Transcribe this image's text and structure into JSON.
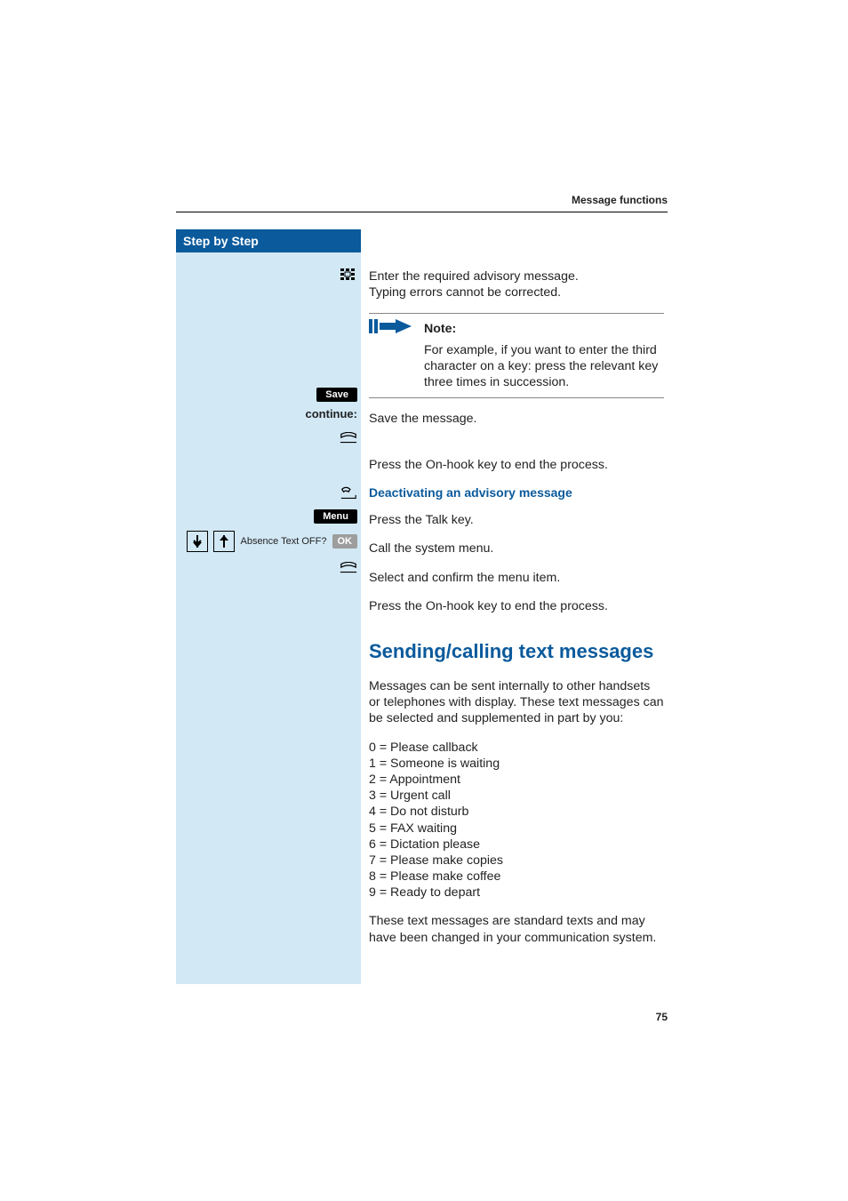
{
  "header": {
    "section": "Message functions"
  },
  "sidebar": {
    "title": "Step by Step"
  },
  "steps": {
    "save": "Save",
    "continue": "continue:",
    "menu": "Menu",
    "absence": "Absence Text OFF?",
    "ok": "OK"
  },
  "body": {
    "p1a": "Enter the required advisory message.",
    "p1b": "Typing errors cannot be corrected.",
    "note_label": "Note:",
    "note_text": "For example, if you want to enter the third character on a key: press the relevant key three times in succession.",
    "save_msg": "Save the message.",
    "onhook1": "Press the On-hook key to end the process.",
    "sub_deact": "Deactivating an advisory message",
    "talk": "Press the Talk key.",
    "callmenu": "Call the system menu.",
    "select": "Select and confirm the menu item.",
    "onhook2": "Press the On-hook key to end the process.",
    "h2": "Sending/calling text messages",
    "p2": "Messages can be sent internally to other handsets or telephones with display. These text messages can be selected and supplemented in part by you:",
    "list": {
      "l0": "0 = Please callback",
      "l1": "1 = Someone is waiting",
      "l2": "2 = Appointment",
      "l3": "3 = Urgent call",
      "l4": "4 = Do not disturb",
      "l5": "5 = FAX waiting",
      "l6": "6 = Dictation please",
      "l7": "7 = Please make copies",
      "l8": "8 = Please make coffee",
      "l9": "9 = Ready to depart"
    },
    "p3": "These text messages are standard texts and may have been changed in your communication system."
  },
  "footer": {
    "page": "75"
  }
}
